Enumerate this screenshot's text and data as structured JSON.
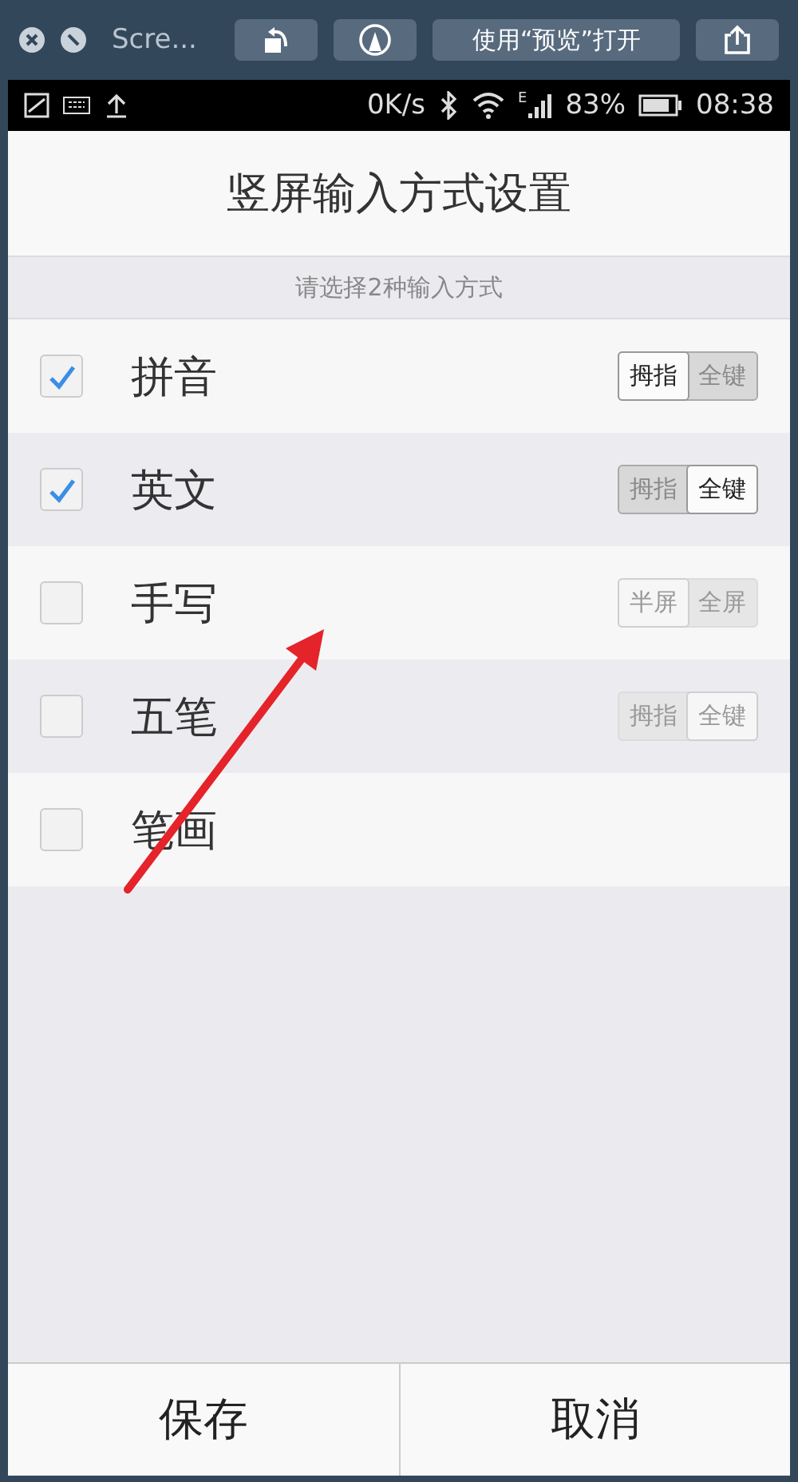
{
  "window": {
    "title": "Scre...",
    "toolbar_buttons": [
      {
        "kind": "rotate"
      },
      {
        "kind": "markup"
      },
      {
        "kind": "text",
        "label": "使用“预览”打开"
      },
      {
        "kind": "share"
      }
    ]
  },
  "status_bar": {
    "speed": "0K/s",
    "network": "E",
    "battery": "83%",
    "time": "08:38"
  },
  "header": {
    "title": "竖屏输入方式设置"
  },
  "hint": "请选择2种输入方式",
  "methods": [
    {
      "name": "拼音",
      "checked": true,
      "disabled": false,
      "options": [
        {
          "label": "拇指",
          "selected": true
        },
        {
          "label": "全键",
          "selected": false
        }
      ]
    },
    {
      "name": "英文",
      "checked": true,
      "disabled": false,
      "options": [
        {
          "label": "拇指",
          "selected": false
        },
        {
          "label": "全键",
          "selected": true
        }
      ]
    },
    {
      "name": "手写",
      "checked": false,
      "disabled": true,
      "options": [
        {
          "label": "半屏",
          "selected": true
        },
        {
          "label": "全屏",
          "selected": false
        }
      ]
    },
    {
      "name": "五笔",
      "checked": false,
      "disabled": true,
      "options": [
        {
          "label": "拇指",
          "selected": false
        },
        {
          "label": "全键",
          "selected": true
        }
      ]
    },
    {
      "name": "笔画",
      "checked": false
    }
  ],
  "buttons": [
    {
      "label": "保存"
    },
    {
      "label": "取消"
    }
  ]
}
